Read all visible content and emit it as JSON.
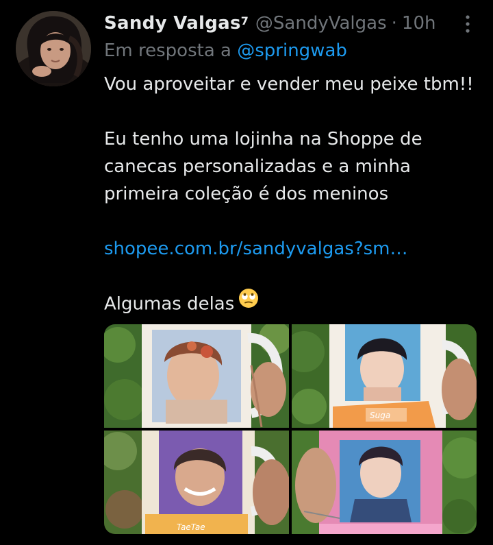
{
  "tweet": {
    "author": {
      "display_name": "Sandy Valgas",
      "name_suffix": "7",
      "handle": "@SandyValgas",
      "time_separator": "·",
      "time": "10h"
    },
    "reply": {
      "prefix": "Em resposta a",
      "mention": "@springwab"
    },
    "body": {
      "line1": "Vou aproveitar e vender meu peixe tbm!!",
      "line2": "Eu tenho uma lojinha na Shoppe de",
      "line3": "canecas personalizadas e a minha",
      "line4": "primeira coleção é dos meninos",
      "link": "shopee.com.br/sandyvalgas?sm…",
      "closing": "Algumas delas"
    },
    "media": {
      "mug2_label": "Suga",
      "mug3_label": "TaeTae"
    }
  },
  "colors": {
    "background": "#000000",
    "text_primary": "#e7e9ea",
    "text_secondary": "#71767b",
    "link": "#1d9bf0"
  },
  "icons": [
    "more-options-icon",
    "rolling-eyes-emoji"
  ]
}
